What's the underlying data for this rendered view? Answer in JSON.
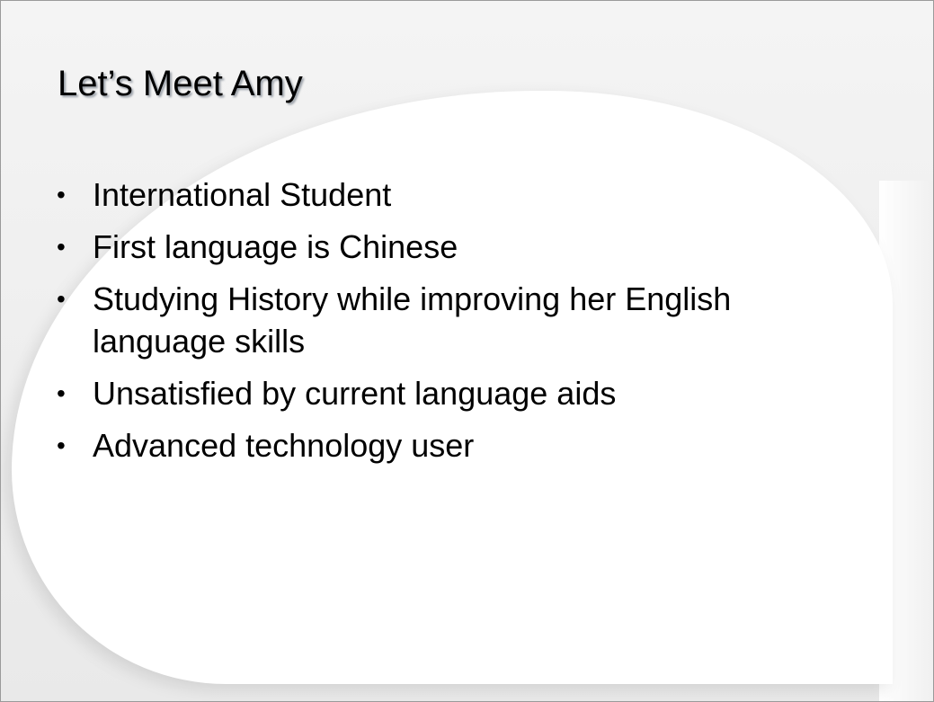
{
  "slide": {
    "title": "Let’s Meet Amy",
    "bullet_marker": "•",
    "bullets": [
      "International Student",
      "First language is Chinese",
      "Studying History while improving her English language skills",
      "Unsatisfied by current language aids",
      "Advanced technology user"
    ]
  }
}
